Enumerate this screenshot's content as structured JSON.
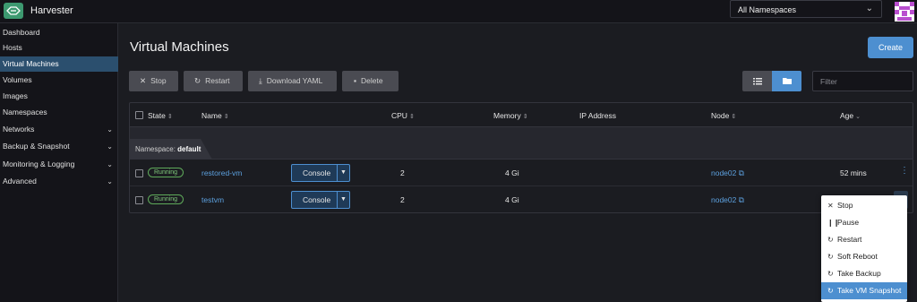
{
  "app": {
    "title": "Harvester"
  },
  "header": {
    "namespace_select": "All Namespaces"
  },
  "sidebar": {
    "items": [
      {
        "label": "Dashboard",
        "expandable": false
      },
      {
        "label": "Hosts",
        "expandable": false
      },
      {
        "label": "Virtual Machines",
        "expandable": false,
        "active": true
      },
      {
        "label": "Volumes",
        "expandable": false
      },
      {
        "label": "Images",
        "expandable": false
      },
      {
        "label": "Namespaces",
        "expandable": false
      },
      {
        "label": "Networks",
        "expandable": true
      },
      {
        "label": "Backup & Snapshot",
        "expandable": true
      },
      {
        "label": "Monitoring & Logging",
        "expandable": true
      },
      {
        "label": "Advanced",
        "expandable": true
      }
    ]
  },
  "page": {
    "title": "Virtual Machines",
    "create_label": "Create"
  },
  "toolbar": {
    "stop_label": "Stop",
    "restart_label": "Restart",
    "download_label": "Download YAML",
    "delete_label": "Delete",
    "filter_placeholder": "Filter"
  },
  "table": {
    "columns": [
      "State",
      "Name",
      "CPU",
      "Memory",
      "IP Address",
      "Node",
      "Age"
    ],
    "group": {
      "prefix": "Namespace:",
      "name": "default"
    },
    "rows": [
      {
        "state": "Running",
        "name": "restored-vm",
        "console": "Console",
        "cpu": "2",
        "memory": "4 Gi",
        "ip": "",
        "node": "node02",
        "age": "52 mins"
      },
      {
        "state": "Running",
        "name": "testvm",
        "console": "Console",
        "cpu": "2",
        "memory": "4 Gi",
        "ip": "",
        "node": "node02",
        "age": ""
      }
    ]
  },
  "context_menu": {
    "items": [
      {
        "label": "Stop",
        "icon": "close-icon"
      },
      {
        "label": "Pause",
        "icon": "pause-icon"
      },
      {
        "label": "Restart",
        "icon": "refresh-icon"
      },
      {
        "label": "Soft Reboot",
        "icon": "refresh-icon"
      },
      {
        "label": "Take Backup",
        "icon": "refresh-icon"
      },
      {
        "label": "Take VM Snapshot",
        "icon": "refresh-icon",
        "highlighted": true
      }
    ]
  },
  "colors": {
    "accent": "#4d8fd0",
    "link": "#5ca0de",
    "running": "#5faa5a",
    "brand": "#3d9970"
  }
}
